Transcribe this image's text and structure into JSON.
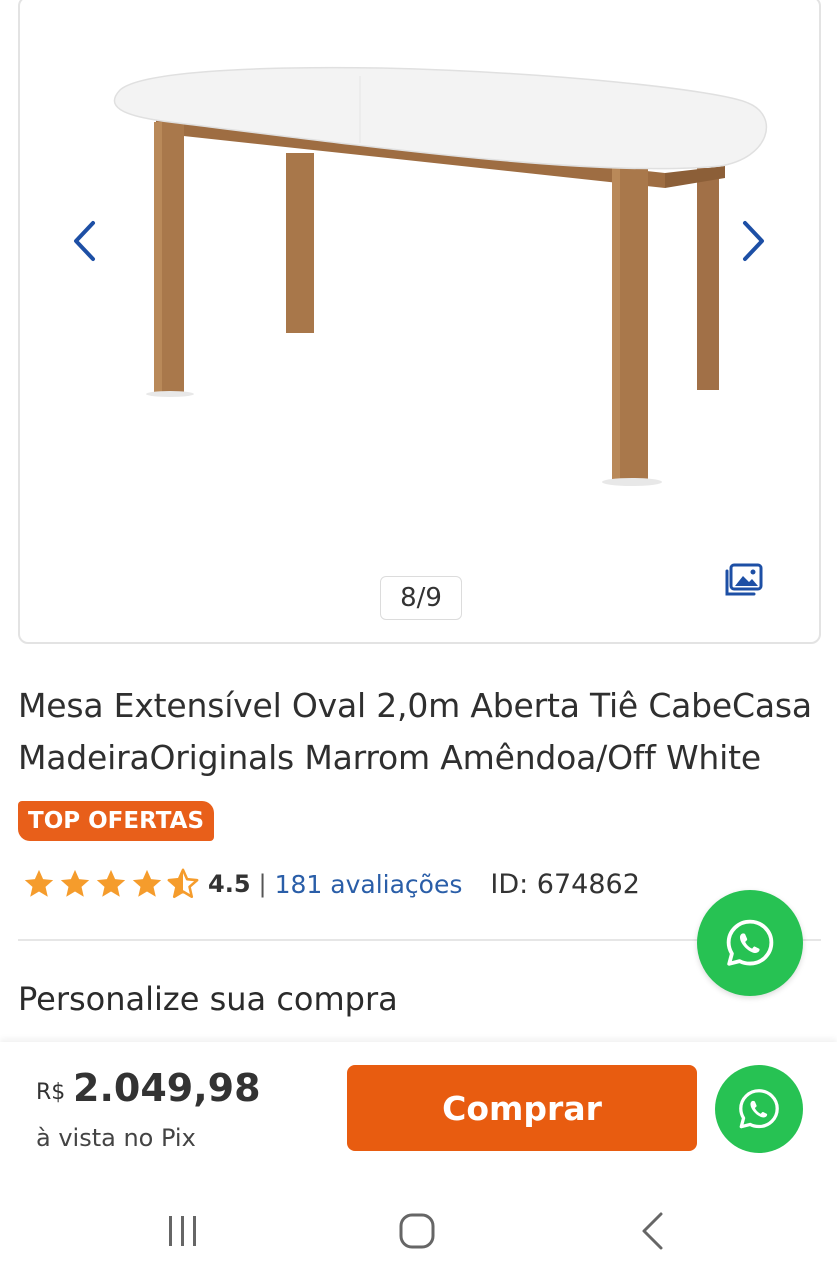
{
  "gallery": {
    "counter": "8/9",
    "image_name": "table-product-photo",
    "arrow_color": "#1d4fa5",
    "icons": {
      "prev": "chevron-left-icon",
      "next": "chevron-right-icon",
      "gallery": "image-gallery-icon"
    }
  },
  "product": {
    "title_line1": "Mesa Extensível Oval 2,0m Aberta Tiê CabeCasa",
    "title_line2": "MadeiraOriginals Marrom Amêndoa/Off White",
    "badge": "TOP OFERTAS",
    "badge_color": "#e85f1a",
    "rating": 4.5,
    "rating_text": "4.5",
    "stars_max": 5,
    "separator": "|",
    "reviews_link": "181 avaliações",
    "id_label": "ID: 674862"
  },
  "section": {
    "title": "Personalize sua compra"
  },
  "bottom_bar": {
    "currency": "R$",
    "price": "2.049,98",
    "price_note": "à vista no Pix",
    "buy_label": "Comprar",
    "buy_color": "#e85c10"
  },
  "whatsapp": {
    "icon": "whatsapp-icon",
    "color": "#27c253"
  },
  "nav": {
    "icons": [
      "recent-apps-icon",
      "home-icon",
      "back-icon"
    ]
  }
}
